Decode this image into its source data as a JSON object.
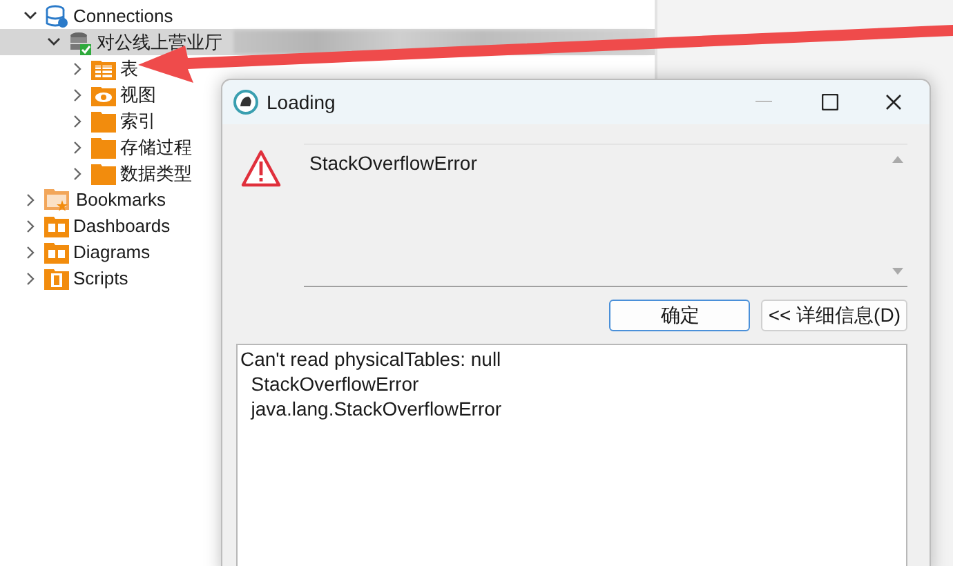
{
  "tree": [
    {
      "label": "Connections",
      "kind": "connections",
      "expanded": true,
      "selected": false,
      "children": [
        {
          "label": "对公线上营业厅",
          "kind": "database",
          "expanded": true,
          "selected": true,
          "children": [
            {
              "label": "表",
              "kind": "tables",
              "expanded": false,
              "selected": false
            },
            {
              "label": "视图",
              "kind": "views",
              "expanded": false,
              "selected": false
            },
            {
              "label": "索引",
              "kind": "folder",
              "expanded": false,
              "selected": false
            },
            {
              "label": "存储过程",
              "kind": "folder",
              "expanded": false,
              "selected": false
            },
            {
              "label": "数据类型",
              "kind": "folder",
              "expanded": false,
              "selected": false
            }
          ]
        }
      ]
    },
    {
      "label": "Bookmarks",
      "kind": "bookmarks",
      "expanded": false,
      "selected": false
    },
    {
      "label": "Dashboards",
      "kind": "dashboards",
      "expanded": false,
      "selected": false
    },
    {
      "label": "Diagrams",
      "kind": "dashboards",
      "expanded": false,
      "selected": false
    },
    {
      "label": "Scripts",
      "kind": "scripts",
      "expanded": false,
      "selected": false
    }
  ],
  "dialog": {
    "title": "Loading",
    "message": "StackOverflowError",
    "buttons": [
      {
        "label": "确定",
        "kind": "default"
      },
      {
        "label": "<< 详细信息(D)",
        "kind": "normal"
      }
    ],
    "details": [
      "Can't read physicalTables: null",
      "  StackOverflowError",
      "  java.lang.StackOverflowError"
    ]
  }
}
